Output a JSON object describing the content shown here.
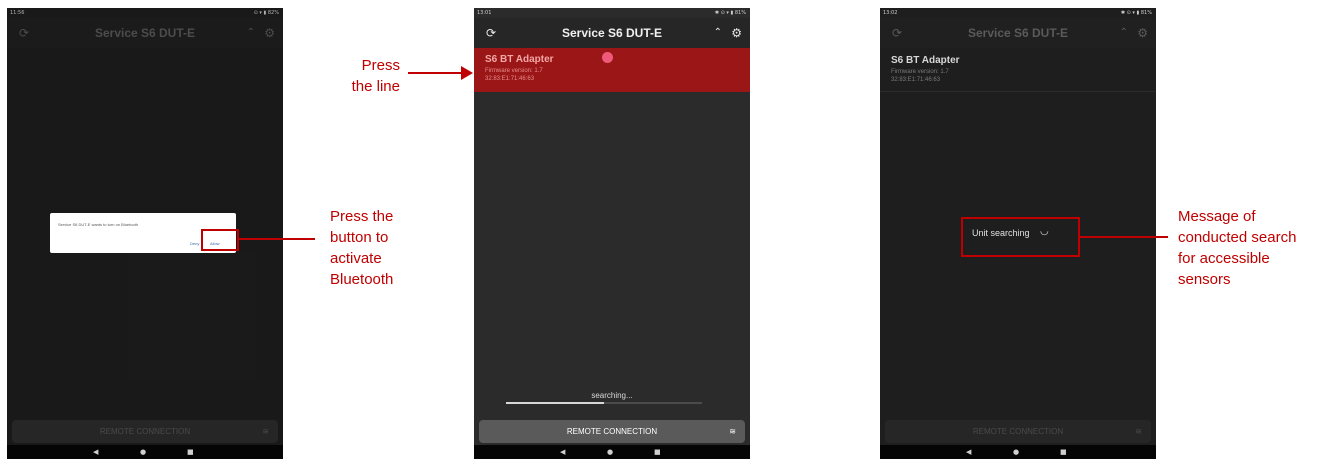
{
  "app": {
    "title": "Service S6 DUT-E"
  },
  "phone1": {
    "status_time": "11:56",
    "status_right": "⊙ ▾ ▮ 82%",
    "dialog_message": "Service S6 DUT-E wants to turn on Bluetooth",
    "dialog_deny": "Deny",
    "dialog_allow": "Allow",
    "bottom_button": "REMOTE CONNECTION"
  },
  "phone2": {
    "status_time": "13:01",
    "status_right": "✱ ⊙ ▾ ▮ 81%",
    "device": {
      "name": "S6 BT Adapter",
      "firmware": "Firmware version: 1.7",
      "mac": "32:83:E1:71:46:63"
    },
    "searching_text": "searching...",
    "search_progress_fraction": 0.5,
    "bottom_button": "REMOTE CONNECTION"
  },
  "phone3": {
    "status_time": "13:02",
    "status_right": "✱ ⊙ ▾ ▮ 81%",
    "device": {
      "name": "S6 BT Adapter",
      "firmware": "Firmware version: 1.7",
      "mac": "32:83:E1:71:46:63"
    },
    "unit_searching": "Unit searching",
    "bottom_button": "REMOTE CONNECTION"
  },
  "annotations": {
    "bluetooth_line1": "Press the",
    "bluetooth_line2": "button to",
    "bluetooth_line3": "activate",
    "bluetooth_line4": "Bluetooth",
    "press_line1": "Press",
    "press_line2": "the line",
    "search_line1": "Message of",
    "search_line2": "conducted search",
    "search_line3": "for accessible",
    "search_line4": "sensors"
  },
  "icons": {
    "refresh": "refresh-icon",
    "collapse": "chevron-up-icon",
    "settings": "gear-icon",
    "wifi": "wifi-icon",
    "back": "back-icon",
    "home": "home-icon",
    "recent": "recent-apps-icon"
  },
  "colors": {
    "accent_red": "#9b1616",
    "annotation_red": "#c00000"
  }
}
